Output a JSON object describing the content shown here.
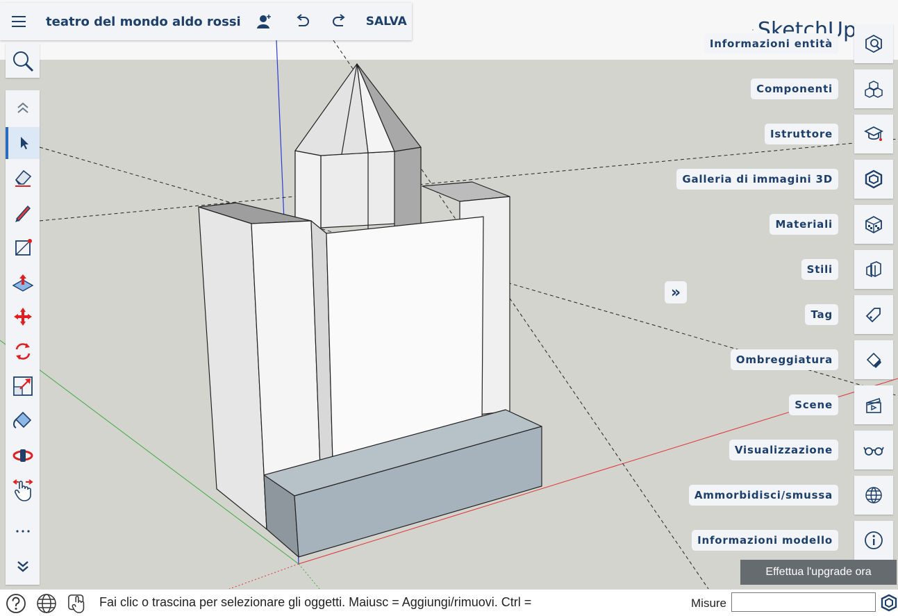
{
  "app": {
    "title": "teatro del mondo aldo rossi",
    "save_label": "SALVA",
    "logo_text": "SketchUp"
  },
  "topbar_icons": [
    "hamburger-menu-icon",
    "add-collaborator-icon",
    "undo-icon",
    "redo-icon"
  ],
  "left_toolbar": {
    "tools": [
      {
        "name": "collapse-up-icon"
      },
      {
        "name": "select-tool-icon",
        "active": true
      },
      {
        "name": "eraser-tool-icon"
      },
      {
        "name": "pencil-tool-icon"
      },
      {
        "name": "rectangle-tool-icon"
      },
      {
        "name": "push-pull-tool-icon"
      },
      {
        "name": "move-tool-icon"
      },
      {
        "name": "rotate-tool-icon"
      },
      {
        "name": "scale-tool-icon"
      },
      {
        "name": "paint-bucket-tool-icon"
      },
      {
        "name": "orbit-tool-icon"
      },
      {
        "name": "pan-tool-icon"
      },
      {
        "name": "more-tools-icon"
      },
      {
        "name": "expand-down-icon"
      }
    ]
  },
  "right_panel": {
    "items": [
      {
        "label": "Informazioni entità",
        "icon": "entity-info-icon"
      },
      {
        "label": "Componenti",
        "icon": "components-icon"
      },
      {
        "label": "Istruttore",
        "icon": "instructor-icon"
      },
      {
        "label": "Galleria di immagini 3D",
        "icon": "3d-warehouse-icon"
      },
      {
        "label": "Materiali",
        "icon": "materials-icon"
      },
      {
        "label": "Stili",
        "icon": "styles-icon"
      },
      {
        "label": "Tag",
        "icon": "tag-icon"
      },
      {
        "label": "Ombreggiatura",
        "icon": "shadows-icon"
      },
      {
        "label": "Scene",
        "icon": "scenes-icon"
      },
      {
        "label": "Visualizzazione",
        "icon": "display-icon"
      },
      {
        "label": "Ammorbidisci/smussa",
        "icon": "soften-edges-icon"
      },
      {
        "label": "Informazioni modello",
        "icon": "model-info-icon"
      }
    ],
    "expand_label": "»"
  },
  "upgrade_label": "Effettua l'upgrade ora",
  "status": {
    "hint": "Fai clic o trascina per selezionare gli oggetti. Maiusc = Aggiungi/rimuovi. Ctrl =",
    "measure_label": "Misure",
    "measure_value": ""
  },
  "colors": {
    "accent": "#1c3f6b",
    "panel_bg": "#f2f4f7",
    "sky": "#f7f7f7",
    "ground": "#d4d4cf",
    "upgrade_bg": "#666b70"
  }
}
